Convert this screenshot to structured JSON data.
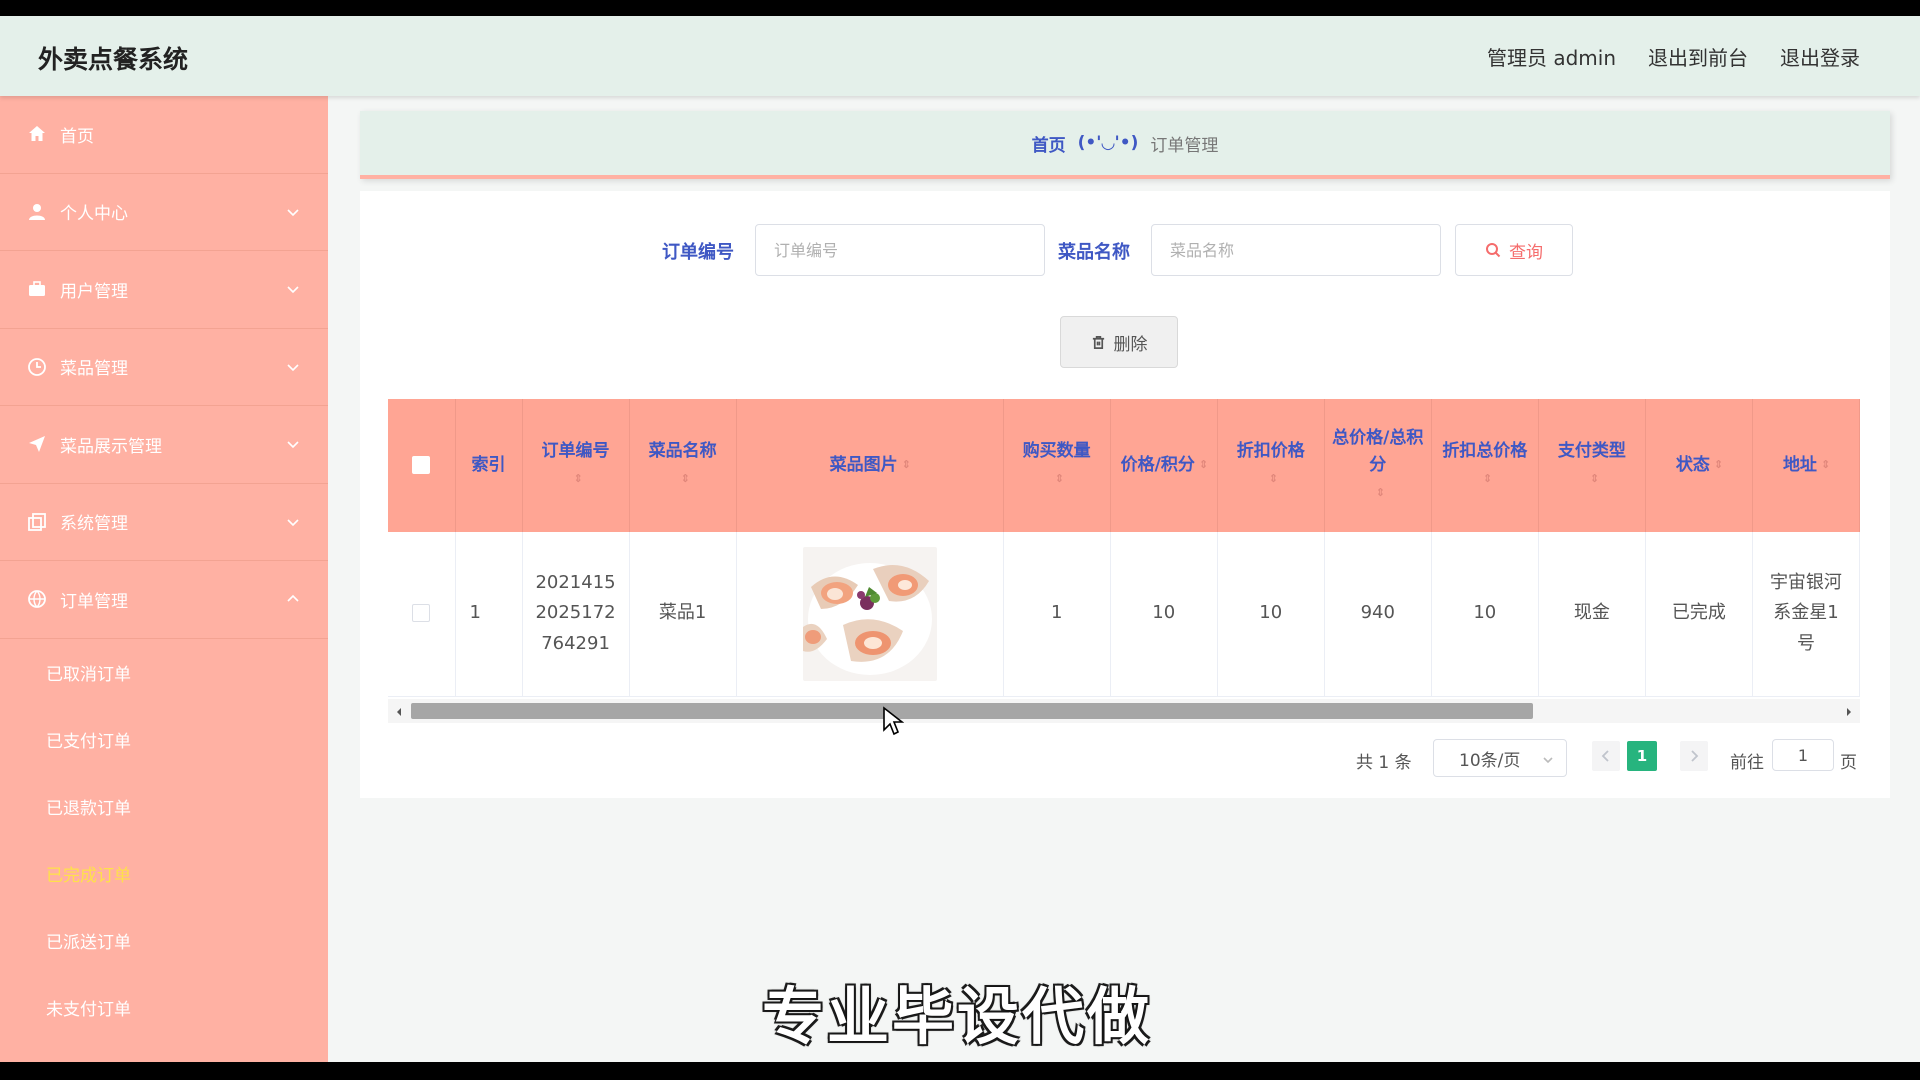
{
  "header": {
    "app_title": "外卖点餐系统",
    "admin_label": "管理员 admin",
    "to_front_label": "退出到前台",
    "logout_label": "退出登录"
  },
  "sidebar": {
    "items": [
      {
        "label": "首页",
        "icon": "home-icon"
      },
      {
        "label": "个人中心",
        "icon": "user-icon"
      },
      {
        "label": "用户管理",
        "icon": "briefcase-icon"
      },
      {
        "label": "菜品管理",
        "icon": "clock-icon"
      },
      {
        "label": "菜品展示管理",
        "icon": "send-icon"
      },
      {
        "label": "系统管理",
        "icon": "copy-icon"
      },
      {
        "label": "订单管理",
        "icon": "globe-icon"
      }
    ],
    "order_submenu": [
      "已取消订单",
      "已支付订单",
      "已退款订单",
      "已完成订单",
      "已派送订单",
      "未支付订单"
    ],
    "active_submenu": "已完成订单",
    "accent_active": "#ffe14a",
    "bg_color": "#ffb1a3"
  },
  "breadcrumb": {
    "home": "首页",
    "separator": "(•'◡'•)",
    "current": "订单管理"
  },
  "search": {
    "order_no_label": "订单编号",
    "order_no_placeholder": "订单编号",
    "dish_name_label": "菜品名称",
    "dish_name_placeholder": "菜品名称",
    "query_label": "查询",
    "delete_label": "删除"
  },
  "table": {
    "headers": [
      "索引",
      "订单编号",
      "菜品名称",
      "菜品图片",
      "购买数量",
      "价格/积分",
      "折扣价格",
      "总价格/总积分",
      "折扣总价格",
      "支付类型",
      "状态",
      "地址"
    ],
    "rows": [
      {
        "index": "1",
        "order_no": "20214152025172764291",
        "order_no_lines": [
          "2021415",
          "2025172",
          "764291"
        ],
        "dish_name": "菜品1",
        "dish_image": "scallop-dish-image",
        "quantity": "1",
        "price": "10",
        "discount_price": "10",
        "total": "940",
        "discount_total": "10",
        "pay_type": "现金",
        "status": "已完成",
        "address_lines": [
          "宇宙银河",
          "系金星1",
          "号"
        ]
      }
    ],
    "header_bg": "#ffa594",
    "header_text_color": "#3f58c4"
  },
  "pagination": {
    "total_text": "共 1 条",
    "page_size": "10条/页",
    "current_page": "1",
    "goto_label": "前往",
    "goto_value": "1",
    "page_suffix": "页",
    "accent": "#27b47e"
  },
  "watermark": "专业毕设代做"
}
